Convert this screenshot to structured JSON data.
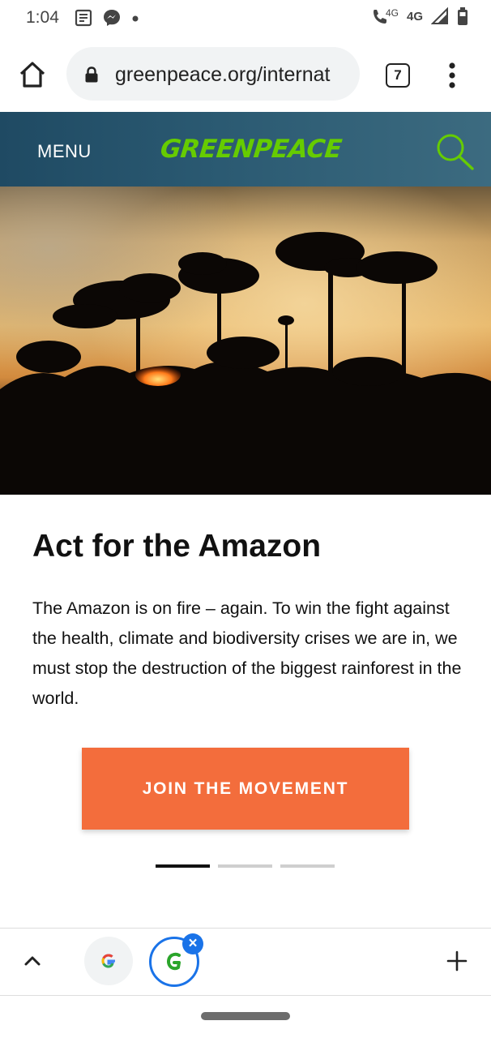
{
  "status": {
    "time": "1:04",
    "network_small": "4G",
    "network": "4G"
  },
  "browser": {
    "url": "greenpeace.org/internat",
    "tab_count": "7"
  },
  "site": {
    "menu_label": "MENU",
    "logo_text": "GREENPEACE",
    "brand_color": "#66cc00"
  },
  "hero": {
    "headline": "Act for the Amazon",
    "body": "The Amazon is on fire – again. To win the fight against the health, climate and biodiversity crises we are in, we must stop the destruction of the biggest rainforest in the world.",
    "cta_label": "JOIN THE MOVEMENT",
    "cta_color": "#f36d3c",
    "carousel": {
      "slide_count": 3,
      "active_index": 0
    }
  },
  "tab_strip": {
    "tabs": [
      {
        "icon": "google-g-icon"
      },
      {
        "icon": "greenpeace-g-icon",
        "active": true
      }
    ]
  }
}
